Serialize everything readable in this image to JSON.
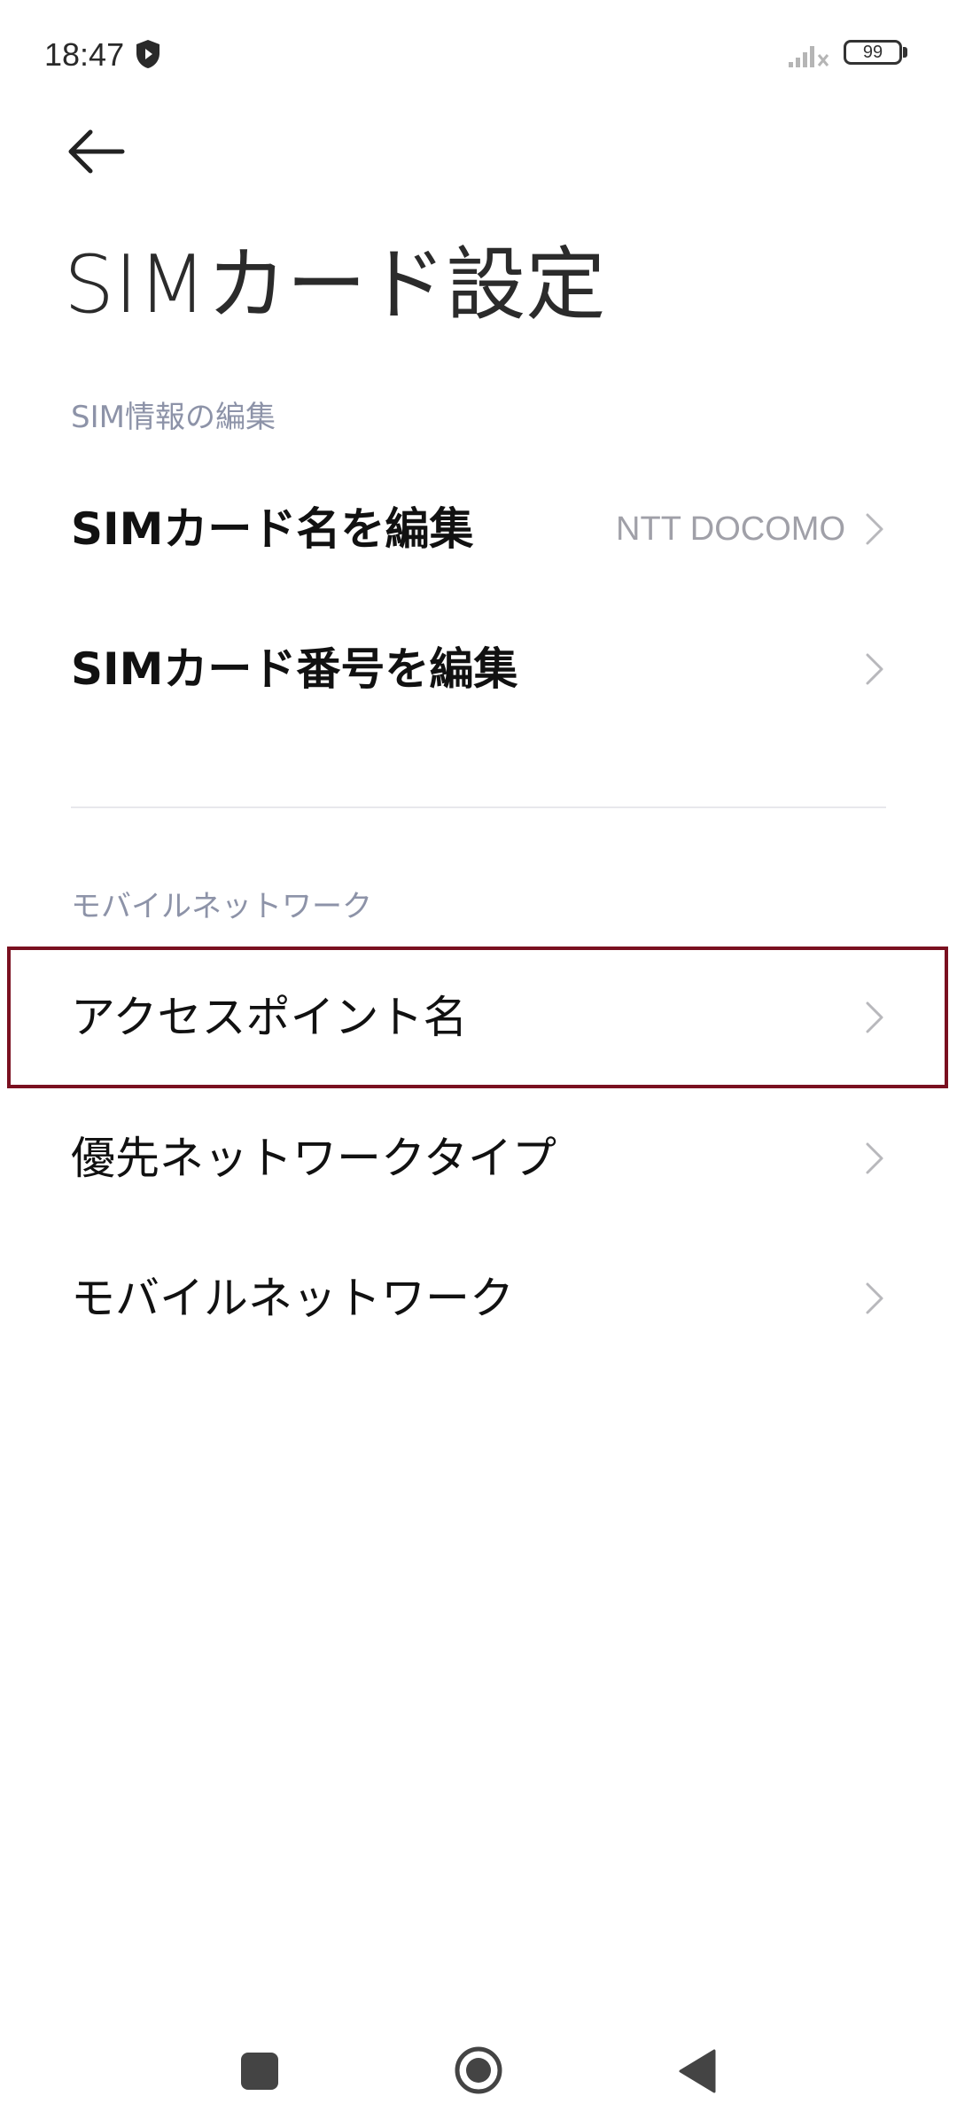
{
  "status_bar": {
    "time": "18:47",
    "battery_level": "99",
    "icons": [
      "shield-icon",
      "signal-icon",
      "battery-icon"
    ]
  },
  "header": {
    "back_icon": "arrow-left-icon",
    "title": "SIMカード設定"
  },
  "sections": [
    {
      "header": "SIM情報の編集",
      "items": [
        {
          "label": "SIMカード名を編集",
          "value": "NTT DOCOMO"
        },
        {
          "label": "SIMカード番号を編集",
          "value": ""
        }
      ]
    },
    {
      "header": "モバイルネットワーク",
      "items": [
        {
          "label": "アクセスポイント名",
          "value": ""
        },
        {
          "label": "優先ネットワークタイプ",
          "value": ""
        },
        {
          "label": "モバイルネットワーク",
          "value": ""
        }
      ]
    }
  ],
  "nav_bar": {
    "icons": [
      "recents-square-icon",
      "home-circle-icon",
      "back-triangle-icon"
    ]
  },
  "colors": {
    "section_header": "#8d93a8",
    "value_text": "#a0a0a8",
    "highlight_border": "#7a1020",
    "divider": "#e8e8ec"
  }
}
